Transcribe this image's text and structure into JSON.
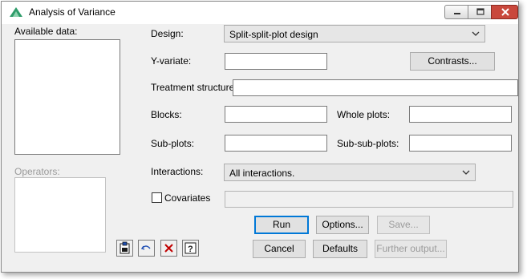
{
  "window": {
    "title": "Analysis of Variance"
  },
  "left_panel": {
    "available_data_label": "Available data:",
    "operators_label": "Operators:"
  },
  "form": {
    "design_label": "Design:",
    "design_value": "Split-split-plot design",
    "y_variate_label": "Y-variate:",
    "y_variate_value": "",
    "contrasts_button": "Contrasts...",
    "treatment_structure_label": "Treatment structure:",
    "treatment_structure_value": "",
    "blocks_label": "Blocks:",
    "blocks_value": "",
    "whole_plots_label": "Whole plots:",
    "whole_plots_value": "",
    "sub_plots_label": "Sub-plots:",
    "sub_plots_value": "",
    "sub_sub_plots_label": "Sub-sub-plots:",
    "sub_sub_plots_value": "",
    "interactions_label": "Interactions:",
    "interactions_value": "All interactions.",
    "covariates_label": "Covariates",
    "covariates_checked": false,
    "covariates_value": ""
  },
  "buttons": {
    "run": "Run",
    "options": "Options...",
    "save": "Save...",
    "cancel": "Cancel",
    "defaults": "Defaults",
    "further_output": "Further output..."
  },
  "toolbar": {
    "icons": [
      "clipboard-icon",
      "undo-icon",
      "clear-icon",
      "help-icon"
    ]
  },
  "colors": {
    "default_button_border": "#0078d7",
    "close_button": "#c9483c",
    "undo_icon": "#1f4fb4",
    "clear_icon": "#c00000"
  }
}
